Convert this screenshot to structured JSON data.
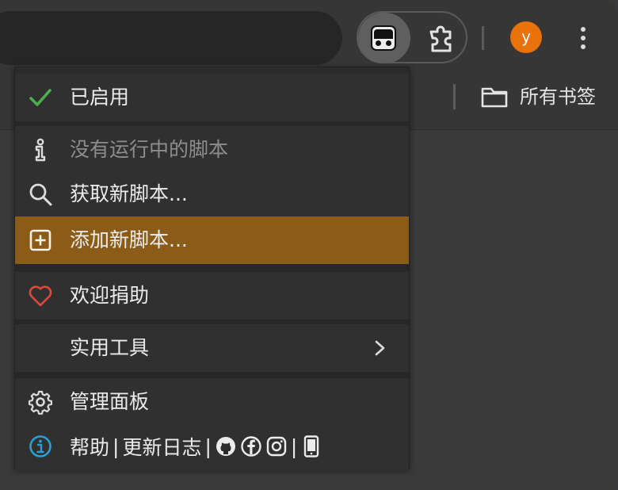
{
  "toolbar": {
    "avatar_initial": "y",
    "extension_active": "tampermonkey-icon",
    "extension_other": "puzzle-icon"
  },
  "bookmarks_bar": {
    "all_bookmarks_label": "所有书签"
  },
  "menu": {
    "enabled_label": "已启用",
    "no_scripts_label": "没有运行中的脚本",
    "get_scripts_label": "获取新脚本...",
    "add_script_label": "添加新脚本...",
    "donate_label": "欢迎捐助",
    "utilities_label": "实用工具",
    "dashboard_label": "管理面板",
    "help_label": "帮助",
    "separator": "|",
    "changelog_label": "更新日志"
  },
  "colors": {
    "accent_highlight": "#8a5c17",
    "check_green": "#4caf50",
    "heart_red": "#e0483a",
    "info_blue": "#2a9fd6",
    "avatar_orange": "#e8710a"
  }
}
